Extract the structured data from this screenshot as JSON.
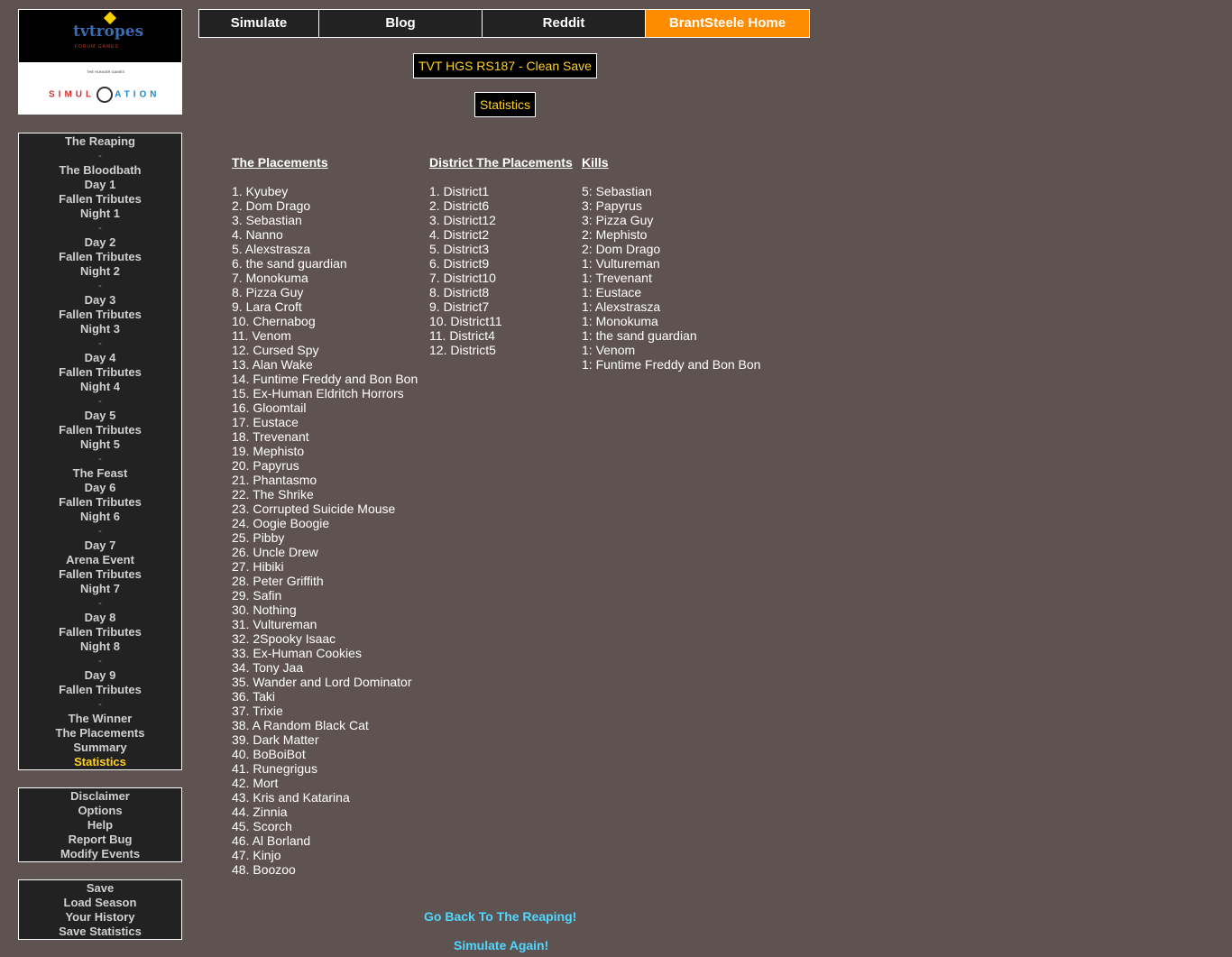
{
  "logo": {
    "brand": "tvtropes",
    "brand_sub": "FORUM GAMES",
    "small_text": "THE HUNGER GAMES",
    "sim_left": "SIMUL",
    "sim_right": "ATION"
  },
  "topnav": [
    "Simulate",
    "Blog",
    "Reddit",
    "BrantSteele Home"
  ],
  "season_title": "TVT HGS RS187 - Clean Save",
  "page_title": "Statistics",
  "sidebar_nav": [
    {
      "label": "The Reaping",
      "sep": false
    },
    {
      "label": "-",
      "sep": true
    },
    {
      "label": "The Bloodbath",
      "sep": false
    },
    {
      "label": "Day 1",
      "sep": false
    },
    {
      "label": "Fallen Tributes",
      "sep": false
    },
    {
      "label": "Night 1",
      "sep": false
    },
    {
      "label": "-",
      "sep": true
    },
    {
      "label": "Day 2",
      "sep": false
    },
    {
      "label": "Fallen Tributes",
      "sep": false
    },
    {
      "label": "Night 2",
      "sep": false
    },
    {
      "label": "-",
      "sep": true
    },
    {
      "label": "Day 3",
      "sep": false
    },
    {
      "label": "Fallen Tributes",
      "sep": false
    },
    {
      "label": "Night 3",
      "sep": false
    },
    {
      "label": "-",
      "sep": true
    },
    {
      "label": "Day 4",
      "sep": false
    },
    {
      "label": "Fallen Tributes",
      "sep": false
    },
    {
      "label": "Night 4",
      "sep": false
    },
    {
      "label": "-",
      "sep": true
    },
    {
      "label": "Day 5",
      "sep": false
    },
    {
      "label": "Fallen Tributes",
      "sep": false
    },
    {
      "label": "Night 5",
      "sep": false
    },
    {
      "label": "-",
      "sep": true
    },
    {
      "label": "The Feast",
      "sep": false
    },
    {
      "label": "Day 6",
      "sep": false
    },
    {
      "label": "Fallen Tributes",
      "sep": false
    },
    {
      "label": "Night 6",
      "sep": false
    },
    {
      "label": "-",
      "sep": true
    },
    {
      "label": "Day 7",
      "sep": false
    },
    {
      "label": "Arena Event",
      "sep": false
    },
    {
      "label": "Fallen Tributes",
      "sep": false
    },
    {
      "label": "Night 7",
      "sep": false
    },
    {
      "label": "-",
      "sep": true
    },
    {
      "label": "Day 8",
      "sep": false
    },
    {
      "label": "Fallen Tributes",
      "sep": false
    },
    {
      "label": "Night 8",
      "sep": false
    },
    {
      "label": "-",
      "sep": true
    },
    {
      "label": "Day 9",
      "sep": false
    },
    {
      "label": "Fallen Tributes",
      "sep": false
    },
    {
      "label": "-",
      "sep": true
    },
    {
      "label": "The Winner",
      "sep": false
    },
    {
      "label": "The Placements",
      "sep": false
    },
    {
      "label": "Summary",
      "sep": false
    },
    {
      "label": "Statistics",
      "sep": false,
      "active": true
    }
  ],
  "sidebar_options": [
    "Disclaimer",
    "Options",
    "Help",
    "Report Bug",
    "Modify Events"
  ],
  "sidebar_save": [
    "Save",
    "Load Season",
    "Your History",
    "Save Statistics"
  ],
  "placements": {
    "header": "The Placements",
    "rows": [
      "1. Kyubey",
      "2. Dom Drago",
      "3. Sebastian",
      "4. Nanno",
      "5. Alexstrasza",
      "6. the sand guardian",
      "7. Monokuma",
      "8. Pizza Guy",
      "9. Lara Croft",
      "10. Chernabog",
      "11. Venom",
      "12. Cursed Spy",
      "13. Alan Wake",
      "14. Funtime Freddy and Bon Bon",
      "15. Ex-Human Eldritch Horrors",
      "16. Gloomtail",
      "17. Eustace",
      "18. Trevenant",
      "19. Mephisto",
      "20. Papyrus",
      "21. Phantasmo",
      "22. The Shrike",
      "23. Corrupted Suicide Mouse",
      "24. Oogie Boogie",
      "25. Pibby",
      "26. Uncle Drew",
      "27. Hibiki",
      "28. Peter Griffith",
      "29. Safin",
      "30. Nothing",
      "31. Vultureman",
      "32. 2Spooky Isaac",
      "33. Ex-Human Cookies",
      "34. Tony Jaa",
      "35. Wander and Lord Dominator",
      "36. Taki",
      "37. Trixie",
      "38. A Random Black Cat",
      "39. Dark Matter",
      "40. BoBoiBot",
      "41. Runegrigus",
      "42. Mort",
      "43. Kris and Katarina",
      "44. Zinnia",
      "45. Scorch",
      "46. Al Borland",
      "47. Kinjo",
      "48. Boozoo"
    ]
  },
  "district_placements": {
    "header": "District The Placements",
    "rows": [
      "1. District1",
      "2. District6",
      "3. District12",
      "4. District2",
      "5. District3",
      "6. District9",
      "7. District10",
      "8. District8",
      "9. District7",
      "10. District11",
      "11. District4",
      "12. District5"
    ]
  },
  "kills": {
    "header": "Kills",
    "rows": [
      "5: Sebastian",
      "3: Papyrus",
      "3: Pizza Guy",
      "2: Mephisto",
      "2: Dom Drago",
      "1: Vultureman",
      "1: Trevenant",
      "1: Eustace",
      "1: Alexstrasza",
      "1: Monokuma",
      "1: the sand guardian",
      "1: Venom",
      "1: Funtime Freddy and Bon Bon"
    ]
  },
  "footer": {
    "back": "Go Back To The Reaping!",
    "again": "Simulate Again!"
  },
  "colors": {
    "background": "#5f5352",
    "panel": "#222222",
    "accent_orange": "#ff8c00",
    "accent_yellow": "#ffd21f",
    "link_cyan": "#4fd7ff"
  }
}
